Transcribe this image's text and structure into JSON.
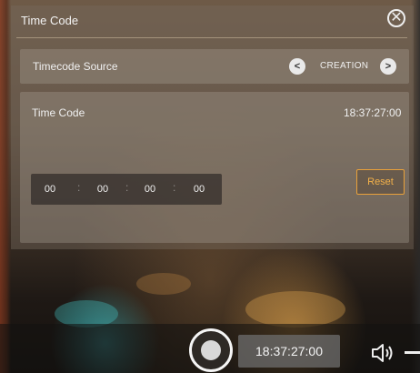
{
  "dialog": {
    "title": "Time Code",
    "close_icon": "close-icon"
  },
  "timecode_source": {
    "label": "Timecode Source",
    "value": "CREATION",
    "prev_icon": "chevron-left-icon",
    "next_icon": "chevron-right-icon"
  },
  "time_code": {
    "label": "Time Code",
    "current_value": "18:37:27:00",
    "fields": {
      "hours": "00",
      "minutes": "00",
      "seconds": "00",
      "frames": "00"
    },
    "reset_label": "Reset"
  },
  "bottom_bar": {
    "timecode_display": "18:37:27:00",
    "record_icon": "record-button-icon",
    "speaker_icon": "speaker-icon"
  },
  "colors": {
    "accent": "#e9a13a",
    "panel": "#9b9085",
    "text": "#f0f0f0"
  }
}
